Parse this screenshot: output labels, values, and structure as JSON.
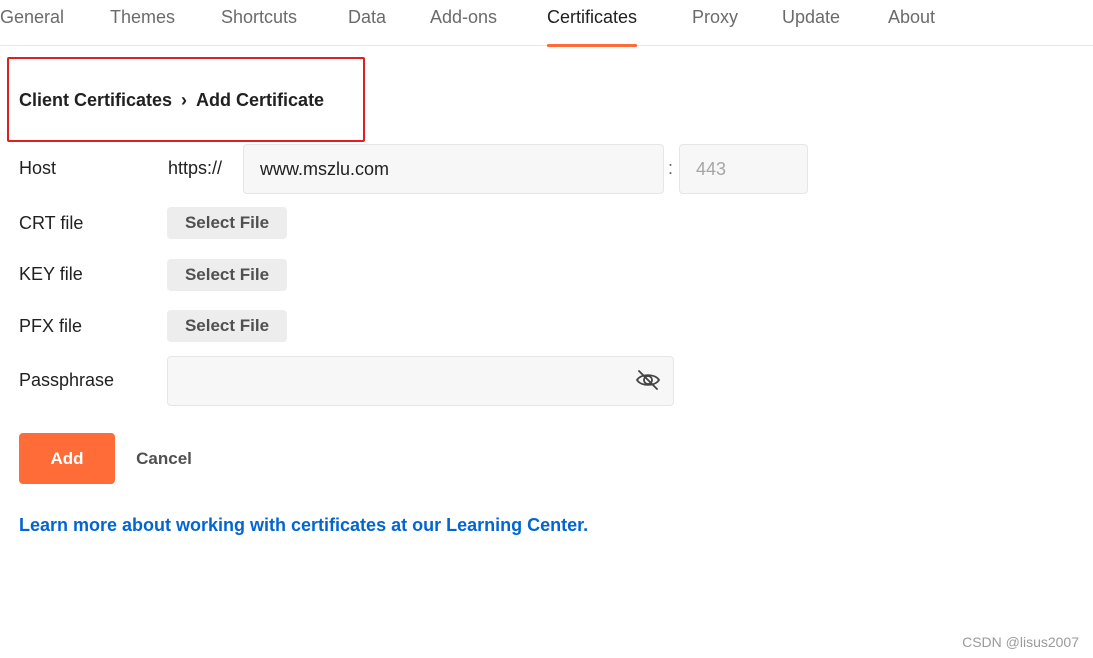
{
  "tabs": [
    {
      "label": "General"
    },
    {
      "label": "Themes"
    },
    {
      "label": "Shortcuts"
    },
    {
      "label": "Data"
    },
    {
      "label": "Add-ons"
    },
    {
      "label": "Certificates",
      "active": true
    },
    {
      "label": "Proxy"
    },
    {
      "label": "Update"
    },
    {
      "label": "About"
    }
  ],
  "breadcrumb": {
    "parent": "Client Certificates",
    "separator": "›",
    "current": "Add Certificate"
  },
  "form": {
    "host_label": "Host",
    "host_prefix": "https://",
    "host_value": "www.mszlu.com",
    "port_separator": ":",
    "port_placeholder": "443",
    "crt_label": "CRT file",
    "key_label": "KEY file",
    "pfx_label": "PFX file",
    "select_file_label": "Select File",
    "passphrase_label": "Passphrase",
    "passphrase_value": ""
  },
  "actions": {
    "add_label": "Add",
    "cancel_label": "Cancel"
  },
  "learn_link": "Learn more about working with certificates at our Learning Center.",
  "watermark": "CSDN @lisus2007",
  "colors": {
    "accent": "#ff6c37",
    "link": "#0265d2",
    "highlight_box": "#e02020"
  },
  "icons": {
    "passphrase_toggle": "eye-slash-icon"
  }
}
